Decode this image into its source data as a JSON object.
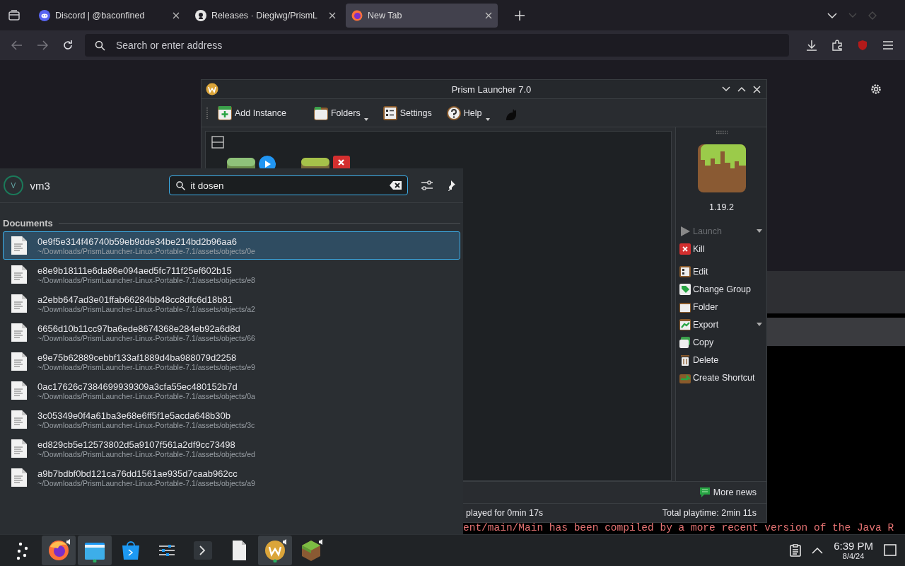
{
  "browser": {
    "tabs": [
      {
        "kind": "discord",
        "title": "Discord | @baconfined",
        "selected": false
      },
      {
        "kind": "github",
        "title": "Releases · Diegiwg/PrismL",
        "selected": false
      },
      {
        "kind": "firefox",
        "title": "New Tab",
        "selected": true
      }
    ],
    "address": {
      "placeholder": "Search or enter address"
    }
  },
  "terminal": {
    "line": "ent/main/Main has been compiled by a more recent version of the Java R"
  },
  "prism": {
    "title": "Prism Launcher 7.0",
    "toolbar": [
      {
        "kind": "add",
        "label": "Add Instance",
        "dropdown": false
      },
      {
        "kind": "folder",
        "label": "Folders",
        "dropdown": true
      },
      {
        "kind": "settings",
        "label": "Settings",
        "dropdown": false
      },
      {
        "kind": "help",
        "label": "Help",
        "dropdown": true
      },
      {
        "kind": "cat",
        "dropdown": false
      }
    ],
    "instance_version": "1.19.2",
    "run_actions": [
      {
        "kind": "launch",
        "label": "Launch",
        "disabled": true,
        "dropdown": true
      },
      {
        "kind": "kill",
        "label": "Kill",
        "disabled": false,
        "dropdown": false
      }
    ],
    "actions": [
      {
        "kind": "edit",
        "label": "Edit",
        "disabled": false,
        "dropdown": false
      },
      {
        "kind": "group",
        "label": "Change Group",
        "disabled": false,
        "dropdown": false
      },
      {
        "kind": "folder",
        "label": "Folder",
        "disabled": false,
        "dropdown": false
      },
      {
        "kind": "export",
        "label": "Export",
        "disabled": false,
        "dropdown": true
      },
      {
        "kind": "copy",
        "label": "Copy",
        "disabled": false,
        "dropdown": false
      },
      {
        "kind": "delete",
        "label": "Delete",
        "disabled": false,
        "dropdown": false
      },
      {
        "kind": "shortcut",
        "label": "Create Shortcut",
        "disabled": false,
        "dropdown": false
      }
    ],
    "more_news": "More news",
    "status_left": "played for 0min 17s",
    "status_right": "Total playtime: 2min 11s"
  },
  "launcher": {
    "avatar_initial": "V",
    "user": "vm3",
    "search": "it dosen",
    "section": "Documents",
    "results": [
      {
        "name": "0e9f5e314f46740b59eb9dde34be214bd2b96aa6",
        "path": "~/Downloads/PrismLauncher-Linux-Portable-7.1/assets/objects/0e",
        "selected": true
      },
      {
        "name": "e8e9b18111e6da86e094aed5fc711f25ef602b15",
        "path": "~/Downloads/PrismLauncher-Linux-Portable-7.1/assets/objects/e8",
        "selected": false
      },
      {
        "name": "a2ebb647ad3e01ffab66284bb48cc8dfc6d18b81",
        "path": "~/Downloads/PrismLauncher-Linux-Portable-7.1/assets/objects/a2",
        "selected": false
      },
      {
        "name": "6656d10b11cc97ba6ede8674368e284eb92a6d8d",
        "path": "~/Downloads/PrismLauncher-Linux-Portable-7.1/assets/objects/66",
        "selected": false
      },
      {
        "name": "e9e75b62889cebbf133af1889d4ba988079d2258",
        "path": "~/Downloads/PrismLauncher-Linux-Portable-7.1/assets/objects/e9",
        "selected": false
      },
      {
        "name": "0ac17626c7384699939309a3cfa55ec480152b7d",
        "path": "~/Downloads/PrismLauncher-Linux-Portable-7.1/assets/objects/0a",
        "selected": false
      },
      {
        "name": "3c05349e0f4a61ba3e68e6ff5f1e5acda648b30b",
        "path": "~/Downloads/PrismLauncher-Linux-Portable-7.1/assets/objects/3c",
        "selected": false
      },
      {
        "name": "ed829cb5e12573802d5a9107f561a2df9cc73498",
        "path": "~/Downloads/PrismLauncher-Linux-Portable-7.1/assets/objects/ed",
        "selected": false
      },
      {
        "name": "a9b7bdbf0bd121ca76dd1561ae935d7caab962cc",
        "path": "~/Downloads/PrismLauncher-Linux-Portable-7.1/assets/objects/a9",
        "selected": false
      }
    ]
  },
  "taskbar": {
    "items": [
      {
        "kind": "menu",
        "open": false,
        "audio": false,
        "plus": false
      },
      {
        "kind": "firefox",
        "open": true,
        "audio": true,
        "plus": false
      },
      {
        "kind": "files",
        "open": true,
        "audio": false,
        "plus": true
      },
      {
        "kind": "store",
        "open": false,
        "audio": false,
        "plus": false
      },
      {
        "kind": "sliders",
        "open": false,
        "audio": false,
        "plus": false
      },
      {
        "kind": "terminal",
        "open": false,
        "audio": false,
        "plus": false
      },
      {
        "kind": "document",
        "open": false,
        "audio": false,
        "plus": false
      },
      {
        "kind": "prism",
        "open": true,
        "audio": true,
        "plus": true
      },
      {
        "kind": "grass",
        "open": false,
        "audio": true,
        "plus": false
      }
    ],
    "time": "6:39 PM",
    "date": "8/4/24"
  }
}
